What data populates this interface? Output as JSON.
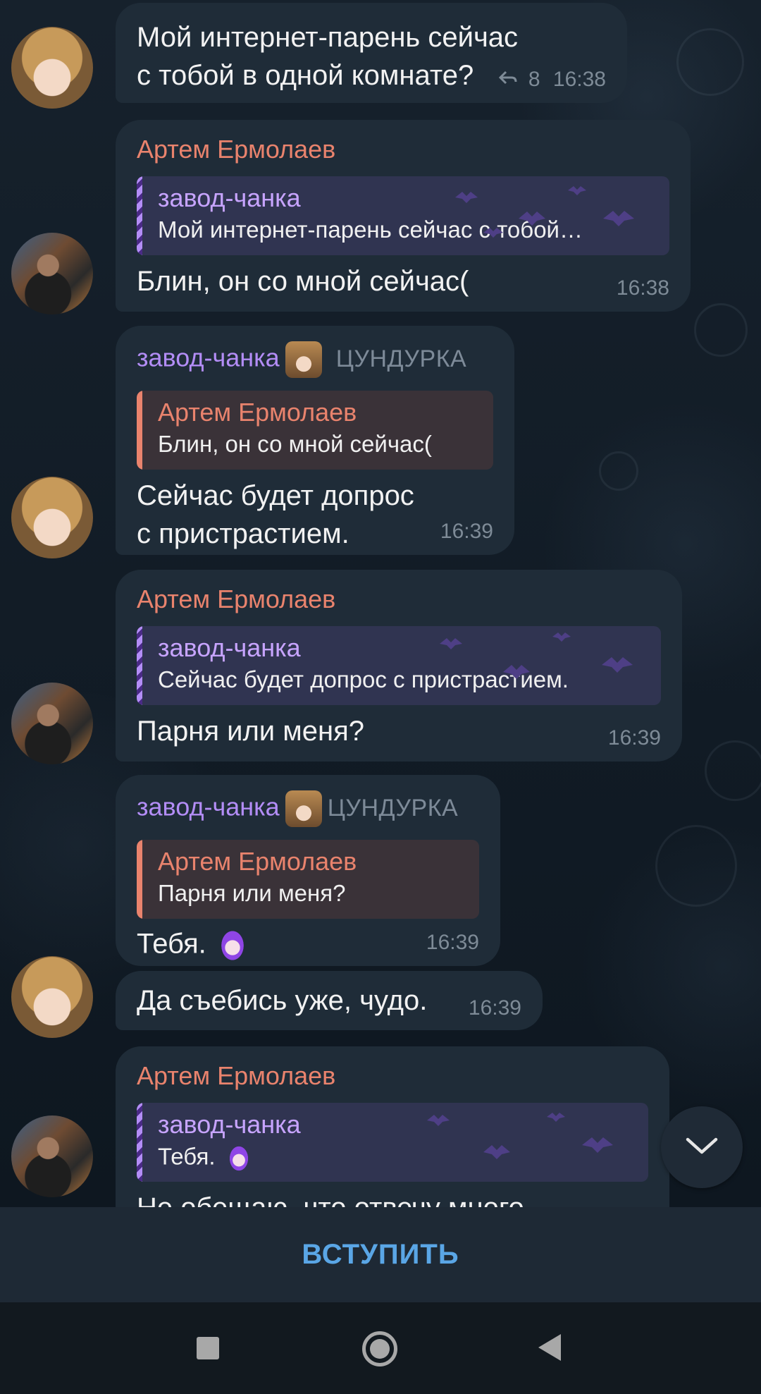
{
  "messages": [
    {
      "text": "Мой интернет-парень сейчас с тобой в одной комнате?",
      "replies": "8",
      "time": "16:38"
    },
    {
      "sender": "Артем Ермолаев",
      "reply_name": "завод-чанка",
      "reply_text": "Мой интернет-парень сейчас с тобой…",
      "text": "Блин, он со мной сейчас(",
      "time": "16:38"
    },
    {
      "sender": "завод-чанка",
      "tag": "ЦУНДУРКА",
      "reply_name": "Артем Ермолаев",
      "reply_text": "Блин, он со мной сейчас(",
      "text": "Сейчас будет допрос с пристрастием.",
      "time": "16:39"
    },
    {
      "sender": "Артем Ермолаев",
      "reply_name": "завод-чанка",
      "reply_text": "Сейчас будет допрос с пристрастием.",
      "text": "Парня или меня?",
      "time": "16:39"
    },
    {
      "sender": "завод-чанка",
      "tag": "ЦУНДУРКА",
      "reply_name": "Артем Ермолаев",
      "reply_text": "Парня или меня?",
      "text": "Тебя.",
      "time": "16:39"
    },
    {
      "text": "Да съебись уже, чудо.",
      "time": "16:39"
    },
    {
      "sender": "Артем Ермолаев",
      "reply_name": "завод-чанка",
      "reply_text": "Тебя.",
      "text": "Не обещаю, что отвечу много"
    }
  ],
  "join_label": "ВСТУПИТЬ",
  "colors": {
    "accent": "#5aa6e6",
    "artem": "#e9836d",
    "zavod": "#b38df6",
    "bubble": "#1f2c38"
  },
  "icons": [
    "reply-forward-icon",
    "chevron-down-icon",
    "recent-apps-icon",
    "home-icon",
    "back-icon"
  ]
}
